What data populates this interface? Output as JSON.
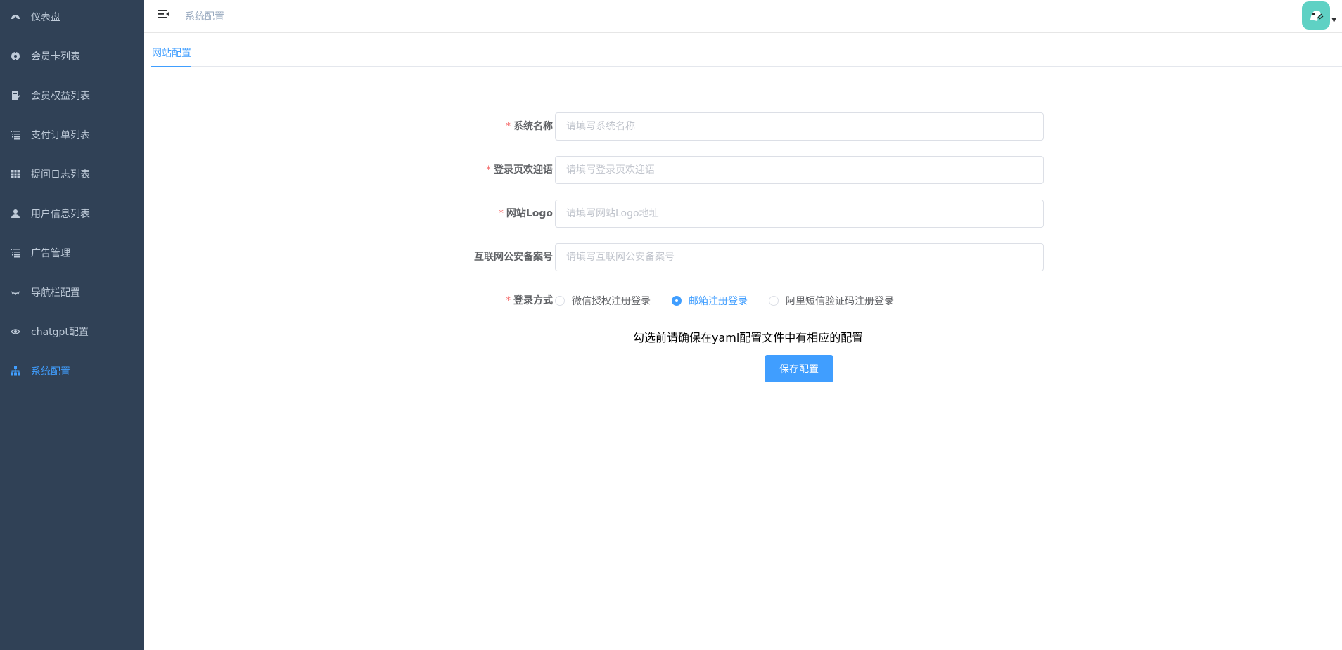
{
  "sidebar": {
    "items": [
      {
        "label": "仪表盘",
        "icon": "dashboard-icon",
        "active": false
      },
      {
        "label": "会员卡列表",
        "icon": "target-icon",
        "active": false
      },
      {
        "label": "会员权益列表",
        "icon": "document-edit-icon",
        "active": false
      },
      {
        "label": "支付订单列表",
        "icon": "list-icon",
        "active": false
      },
      {
        "label": "提问日志列表",
        "icon": "table-icon",
        "active": false
      },
      {
        "label": "用户信息列表",
        "icon": "user-icon",
        "active": false
      },
      {
        "label": "广告管理",
        "icon": "list-icon",
        "active": false
      },
      {
        "label": "导航栏配置",
        "icon": "eye-closed-icon",
        "active": false
      },
      {
        "label": "chatgpt配置",
        "icon": "eye-icon",
        "active": false
      },
      {
        "label": "系统配置",
        "icon": "tree-icon",
        "active": true
      }
    ]
  },
  "header": {
    "breadcrumb": "系统配置",
    "avatar_icon": "avatar-icon"
  },
  "tabs": [
    {
      "label": "网站配置",
      "active": true
    }
  ],
  "form": {
    "fields": [
      {
        "label": "系统名称",
        "required": true,
        "value": "",
        "placeholder": "请填写系统名称"
      },
      {
        "label": "登录页欢迎语",
        "required": true,
        "value": "",
        "placeholder": "请填写登录页欢迎语"
      },
      {
        "label": "网站Logo",
        "required": true,
        "value": "",
        "placeholder": "请填写网站Logo地址"
      },
      {
        "label": "互联网公安备案号",
        "required": false,
        "value": "",
        "placeholder": "请填写互联网公安备案号"
      }
    ],
    "login_method": {
      "label": "登录方式",
      "required": true,
      "options": [
        {
          "label": "微信授权注册登录",
          "checked": false
        },
        {
          "label": "邮箱注册登录",
          "checked": true
        },
        {
          "label": "阿里短信验证码注册登录",
          "checked": false
        }
      ]
    },
    "hint": "勾选前请确保在yaml配置文件中有相应的配置",
    "save_label": "保存配置"
  },
  "colors": {
    "sidebar_bg": "#304156",
    "sidebar_text": "#bfcbd9",
    "accent": "#409eff",
    "required": "#f56c6c",
    "avatar_bg": "#5fd1c4"
  }
}
